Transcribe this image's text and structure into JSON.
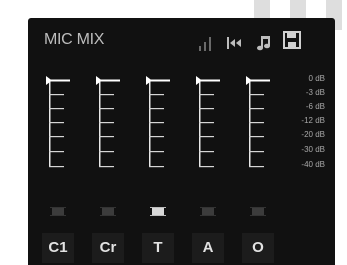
{
  "app": {
    "title": "MIC MIX"
  },
  "toolbar": {
    "icons": [
      "signal-bars-icon",
      "swap-arrows-icon",
      "music-note-icon",
      "save-icon"
    ]
  },
  "scale": {
    "labels": [
      "0 dB",
      "-3 dB",
      "-6 dB",
      "-12 dB",
      "-20 dB",
      "-30 dB",
      "-40 dB"
    ]
  },
  "channels": [
    {
      "label": "C1",
      "active": false,
      "level_db": 0
    },
    {
      "label": "Cr",
      "active": false,
      "level_db": 0
    },
    {
      "label": "T",
      "active": true,
      "level_db": 0
    },
    {
      "label": "A",
      "active": false,
      "level_db": 0
    },
    {
      "label": "O",
      "active": false,
      "level_db": 0
    }
  ],
  "colors": {
    "panel": "#111111",
    "text": "#e2e2e2",
    "led_off": "#3c3c3c",
    "led_on": "#d8d8d8",
    "fader": "#ffffff"
  }
}
